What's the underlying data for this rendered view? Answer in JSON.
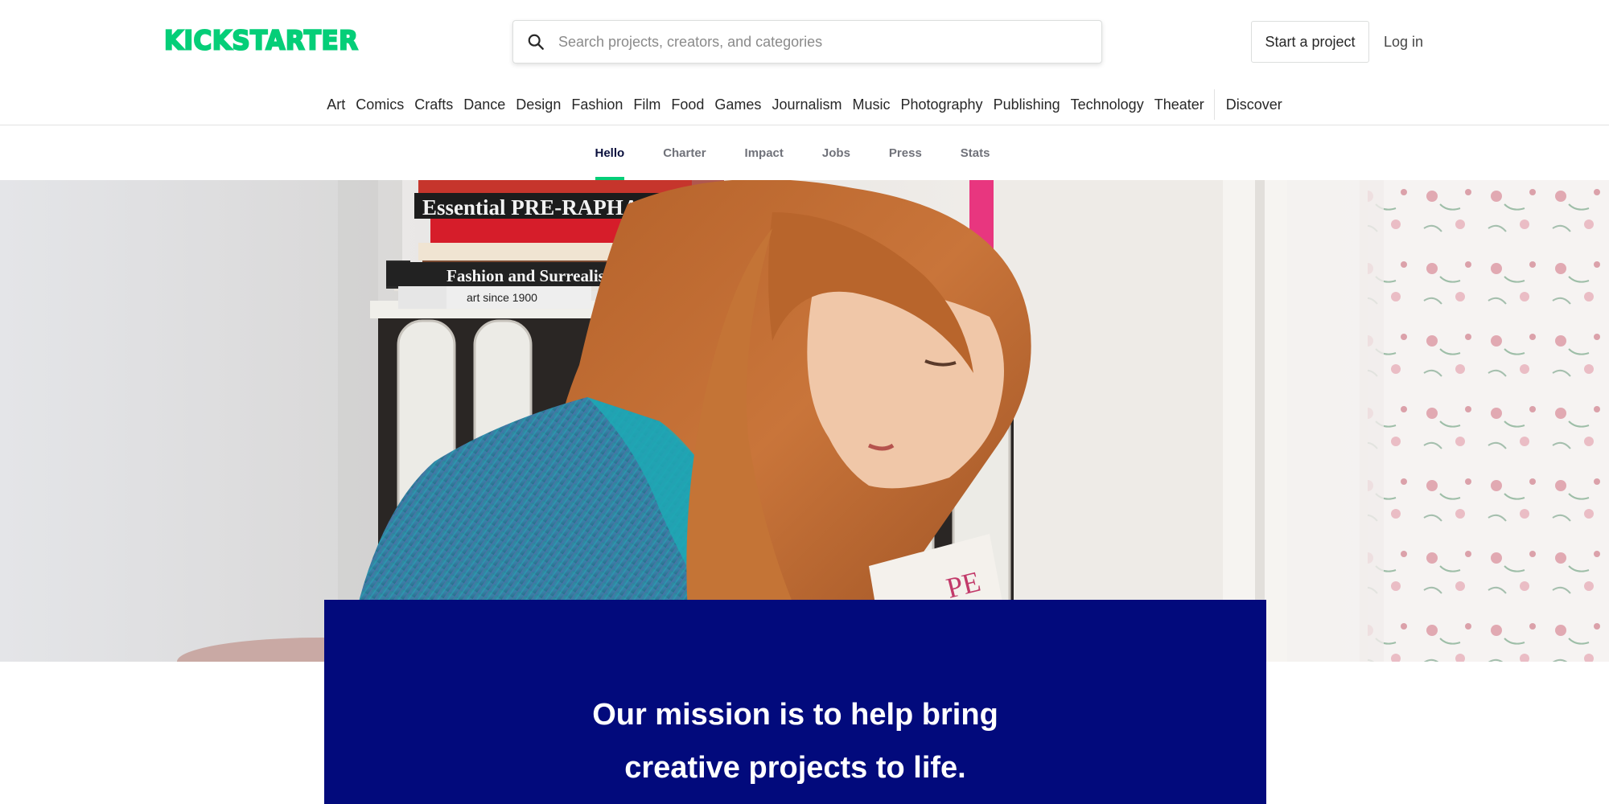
{
  "header": {
    "logo_text": "KICKSTARTER",
    "search_placeholder": "Search projects, creators, and categories",
    "start_project_label": "Start a project",
    "login_label": "Log in"
  },
  "categories": [
    "Art",
    "Comics",
    "Crafts",
    "Dance",
    "Design",
    "Fashion",
    "Film",
    "Food",
    "Games",
    "Journalism",
    "Music",
    "Photography",
    "Publishing",
    "Technology",
    "Theater"
  ],
  "discover_label": "Discover",
  "subnav": {
    "items": [
      "Hello",
      "Charter",
      "Impact",
      "Jobs",
      "Press",
      "Stats"
    ],
    "active": "Hello"
  },
  "hero": {
    "book_titles": [
      "Essential PRE-RAPHAELITES",
      "Fashion and Surrealism",
      "art since 1900",
      "PE"
    ]
  },
  "mission": {
    "text": "Our mission is to help bring creative projects to life."
  },
  "colors": {
    "brand": "#05ce78",
    "mission_bg": "#020a7c",
    "active_tab": "#0a0f3d"
  }
}
